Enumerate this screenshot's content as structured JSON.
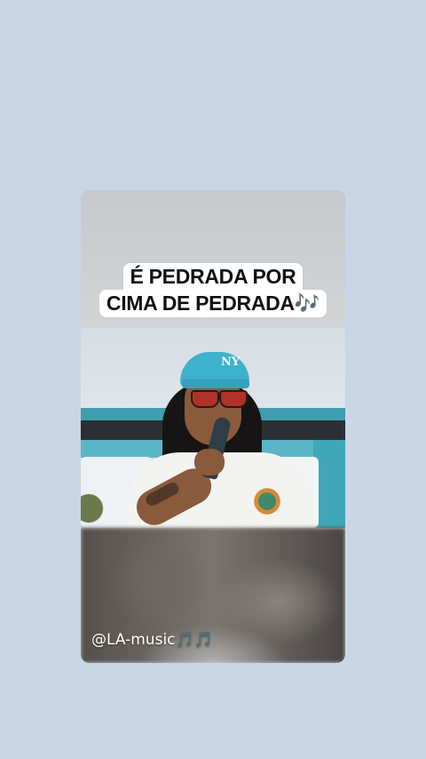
{
  "caption": {
    "line1": "É PEDRADA POR",
    "line2": "CIMA DE PEDRADA🎶"
  },
  "cap_logo": "NY",
  "watermark": {
    "handle": "@LA-music",
    "emoji": "🎵🎵"
  },
  "colors": {
    "background": "#c9d6e6",
    "caption_bg": "#ffffff",
    "cap": "#3eb1cc",
    "accent_notes": "#8b3fe0"
  }
}
